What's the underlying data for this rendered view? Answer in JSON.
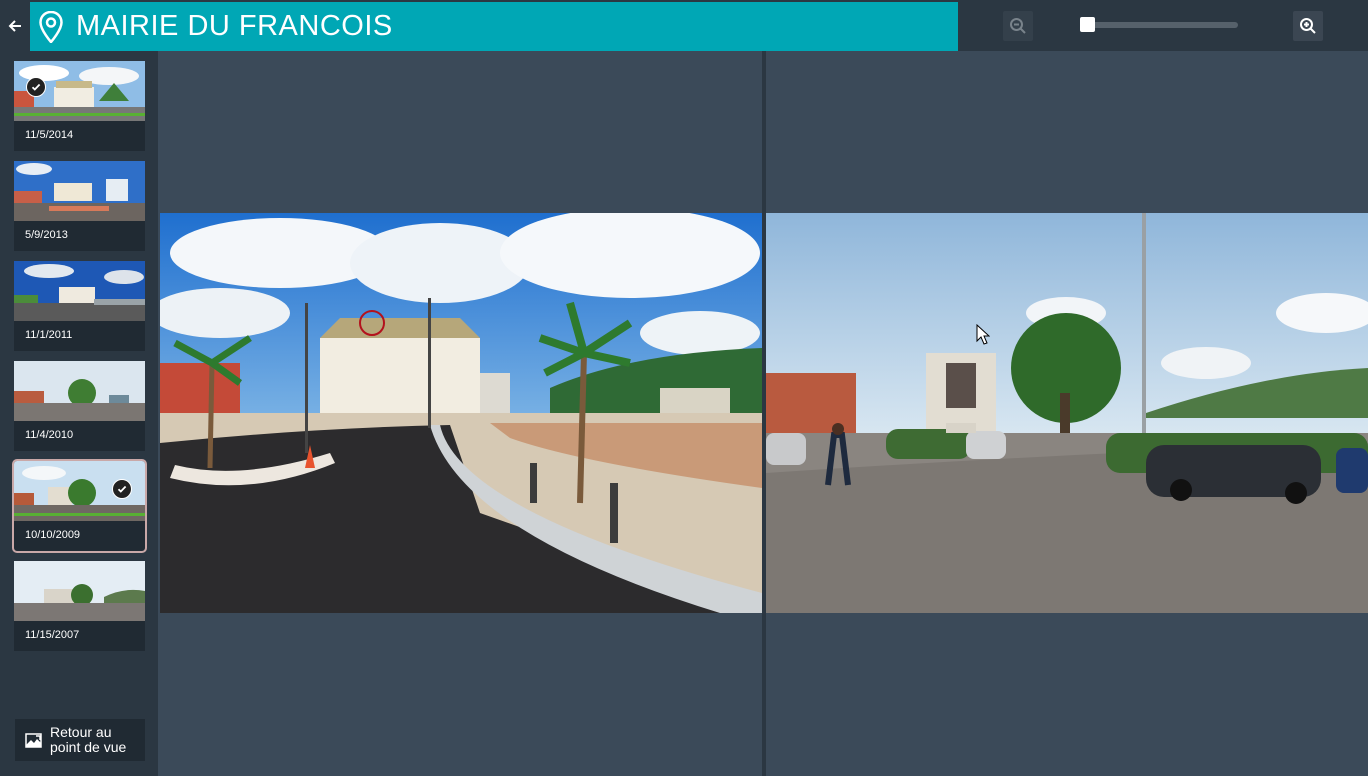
{
  "header": {
    "title": "MAIRIE DU FRANCOIS",
    "back_icon": "arrow-left-icon",
    "location_icon": "map-pin-icon",
    "accent_color": "#00a7b5"
  },
  "zoom": {
    "zoom_out_icon": "zoom-out-icon",
    "zoom_in_icon": "zoom-in-icon",
    "level": 0
  },
  "thumbnails": [
    {
      "date": "11/5/2014",
      "checked": true
    },
    {
      "date": "5/9/2013",
      "checked": false
    },
    {
      "date": "11/1/2011",
      "checked": false
    },
    {
      "date": "11/4/2010",
      "checked": false
    },
    {
      "date": "10/10/2009",
      "checked": true,
      "selected": true
    },
    {
      "date": "11/15/2007",
      "checked": false
    }
  ],
  "return_button": {
    "label": "Retour au point de vue",
    "icon": "return-view-icon"
  }
}
